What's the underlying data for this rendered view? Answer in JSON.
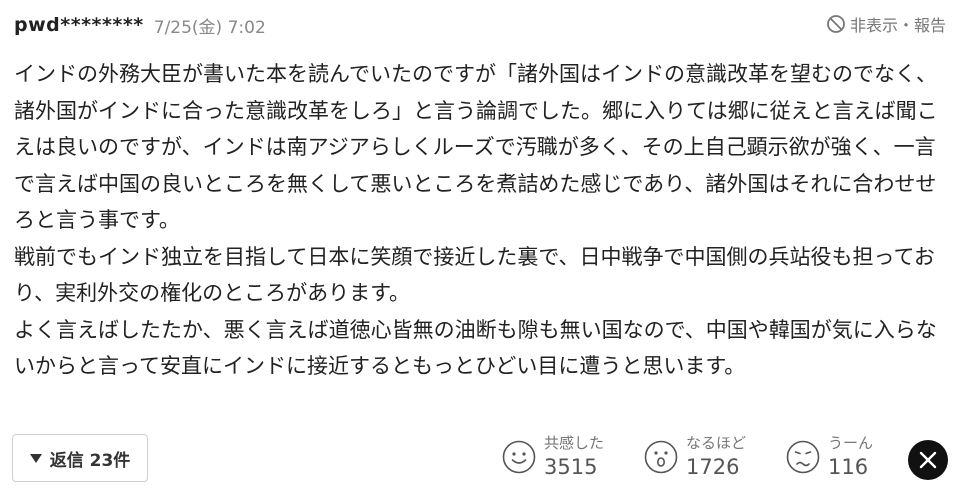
{
  "comment": {
    "username": "pwd********",
    "timestamp": "7/25(金) 7:02",
    "report_label": "非表示・報告",
    "body": "インドの外務大臣が書いた本を読んでいたのですが「諸外国はインドの意識改革を望むのでなく、諸外国がインドに合った意識改革をしろ」と言う論調でした。郷に入りては郷に従えと言えば聞こえは良いのですが、インドは南アジアらしくルーズで汚職が多く、その上自己顕示欲が強く、一言で言えば中国の良いところを無くして悪いところを煮詰めた感じであり、諸外国はそれに合わせせろと言う事です。\n戦前でもインド独立を目指して日本に笑顔で接近した裏で、日中戦争で中国側の兵站役も担っており、実利外交の権化のところがあります。\nよく言えばしたたか、悪く言えば道徳心皆無の油断も隙も無い国なので、中国や韓国が気に入らないからと言って安直にインドに接近するともっとひどい目に遭うと思います。"
  },
  "actions": {
    "reply_label": "返信 23件",
    "reactions": [
      {
        "label": "共感した",
        "count": "3515",
        "icon": "smile-face-icon"
      },
      {
        "label": "なるほど",
        "count": "1726",
        "icon": "surprised-face-icon"
      },
      {
        "label": "うーん",
        "count": "116",
        "icon": "thinking-face-icon"
      }
    ],
    "share_icon": "x-logo-icon"
  }
}
